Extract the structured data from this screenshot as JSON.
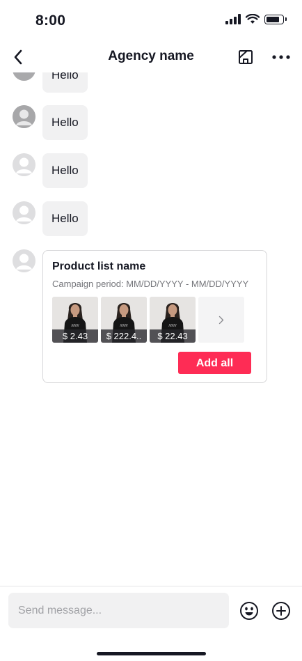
{
  "status_bar": {
    "time": "8:00"
  },
  "header": {
    "title": "Agency name"
  },
  "messages": [
    {
      "text": "Hello"
    },
    {
      "text": "Hello"
    },
    {
      "text": "Hello"
    },
    {
      "text": "Hello"
    }
  ],
  "product_card": {
    "name": "Product list name",
    "period": "Campaign period: MM/DD/YYYY - MM/DD/YYYY",
    "products": [
      {
        "price": "$ 2.43"
      },
      {
        "price": "$ 222.4.."
      },
      {
        "price": "$ 22.43"
      }
    ],
    "add_all_label": "Add all"
  },
  "composer": {
    "placeholder": "Send message..."
  },
  "colors": {
    "accent": "#fe2c55",
    "bubble": "#f1f1f2",
    "text": "#161823"
  }
}
